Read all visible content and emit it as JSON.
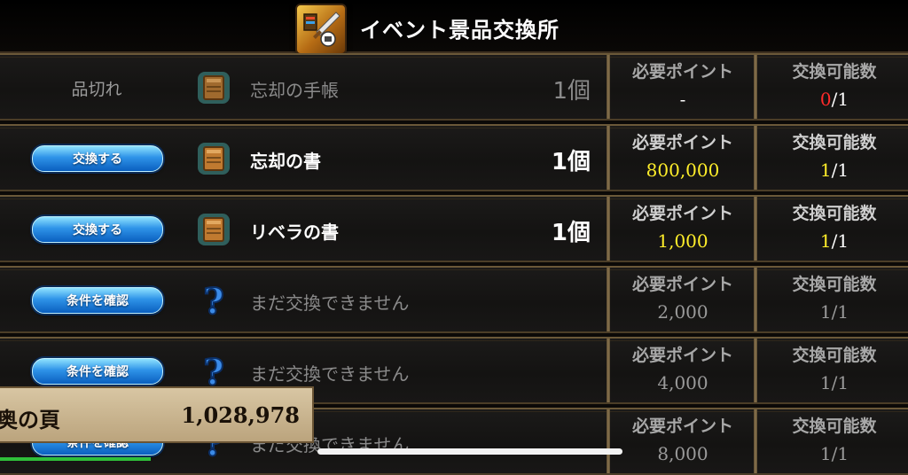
{
  "header": {
    "title": "イベント景品交換所",
    "icon": "event-shop-icon"
  },
  "labels": {
    "required_points": "必要ポイント",
    "exchangeable_count": "交換可能数"
  },
  "rows": [
    {
      "action": "品切れ",
      "action_type": "status",
      "item_icon": "book-icon",
      "item_name": "忘却の手帳",
      "quantity": "1個",
      "points": "-",
      "exchange_used": "0",
      "exchange_total": "/1",
      "dim": true
    },
    {
      "action": "交換する",
      "action_type": "button",
      "item_icon": "book-icon",
      "item_name": "忘却の書",
      "quantity": "1個",
      "points": "800,000",
      "exchange_used": "1",
      "exchange_total": "/1",
      "dim": false
    },
    {
      "action": "交換する",
      "action_type": "button",
      "item_icon": "book-icon",
      "item_name": "リベラの書",
      "quantity": "1個",
      "points": "1,000",
      "exchange_used": "1",
      "exchange_total": "/1",
      "dim": false
    },
    {
      "action": "条件を確認",
      "action_type": "button",
      "item_icon": "question-icon",
      "item_name": "まだ交換できません",
      "quantity": "",
      "points": "2,000",
      "exchange_used": "1",
      "exchange_total": "/1",
      "dim": true
    },
    {
      "action": "条件を確認",
      "action_type": "button",
      "item_icon": "question-icon",
      "item_name": "まだ交換できません",
      "quantity": "",
      "points": "4,000",
      "exchange_used": "1",
      "exchange_total": "/1",
      "dim": true
    },
    {
      "action": "条件を確認",
      "action_type": "button",
      "item_icon": "question-icon",
      "item_name": "まだ交換できません",
      "quantity": "",
      "points": "8,000",
      "exchange_used": "1",
      "exchange_total": "/1",
      "dim": true
    }
  ],
  "points_panel": {
    "label": "奥の頁",
    "value": "1,028,978"
  },
  "colors": {
    "points_highlight": "#ffee2a",
    "sold_out_count": "#ff2a2a",
    "button_blue": "#2e93e8"
  }
}
